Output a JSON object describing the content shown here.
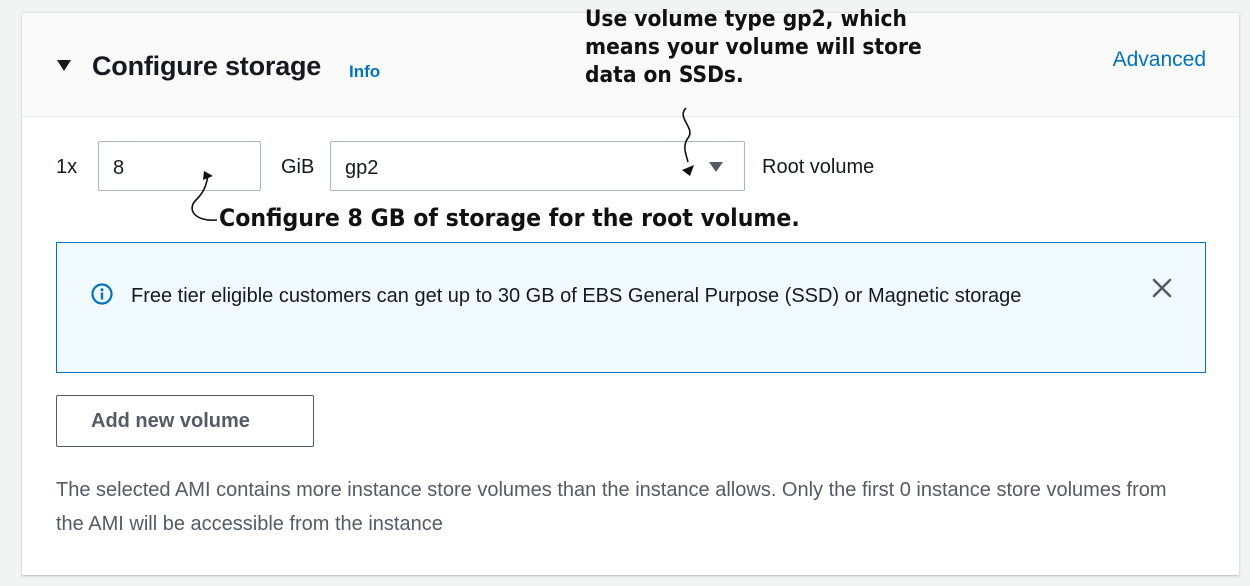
{
  "section": {
    "title": "Configure storage",
    "info_link": "Info",
    "advanced_link": "Advanced"
  },
  "volume_row": {
    "multiplier": "1x",
    "size_value": "8",
    "size_unit": "GiB",
    "volume_type": "gp2",
    "volume_label": "Root volume"
  },
  "alert": {
    "message": "Free tier eligible customers can get up to 30 GB of EBS General Purpose (SSD) or Magnetic storage"
  },
  "add_button": {
    "label": "Add new volume"
  },
  "footnote": "The selected AMI contains more instance store volumes than the instance allows. Only the first 0 instance store volumes from the AMI will be accessible from the instance",
  "annotations": {
    "volume_type_note": "Use volume type gp2, which means your volume will store data on SSDs.",
    "size_note": "Configure 8 GB of storage for the root volume."
  },
  "colors": {
    "link": "#0073bb",
    "alert_border": "#0073bb",
    "alert_background": "#f1faff",
    "text": "#16191f",
    "secondary_text": "#545b64"
  },
  "icons": {
    "caret": "caret-down-icon",
    "info": "info-circle-icon",
    "close": "close-icon",
    "dropdown": "dropdown-arrow-icon"
  }
}
